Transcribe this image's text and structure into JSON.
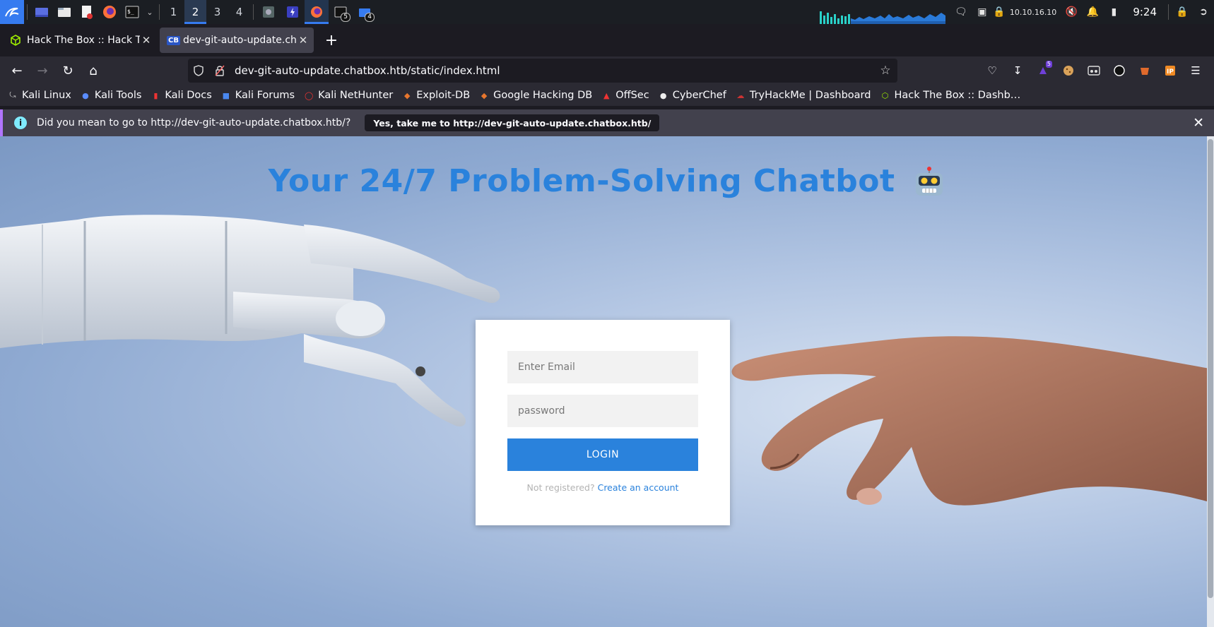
{
  "panel": {
    "workspaces": [
      "1",
      "2",
      "3",
      "4"
    ],
    "active_workspace": "2",
    "task_badges": [
      "5",
      "4"
    ],
    "ip": "10.10.16.10",
    "time": "9:24"
  },
  "tabs": [
    {
      "title": "Hack The Box :: Hack The Box",
      "icon": "htb-cube-icon",
      "active": false
    },
    {
      "title": "dev-git-auto-update.chatbox.htb/static/index.html",
      "icon_text": "CB",
      "active": true
    }
  ],
  "url": "dev-git-auto-update.chatbox.htb/static/index.html",
  "extension_badge": "5",
  "bookmarks": [
    "Kali Linux",
    "Kali Tools",
    "Kali Docs",
    "Kali Forums",
    "Kali NetHunter",
    "Exploit-DB",
    "Google Hacking DB",
    "OffSec",
    "CyberChef",
    "TryHackMe | Dashboard",
    "Hack The Box :: Dashb…"
  ],
  "notification": {
    "text": "Did you mean to go to http://dev-git-auto-update.chatbox.htb/?",
    "button": "Yes, take me to http://dev-git-auto-update.chatbox.htb/"
  },
  "page": {
    "headline": "Your 24/7 Problem-Solving Chatbot",
    "email_placeholder": "Enter Email",
    "password_placeholder": "password",
    "login_label": "LOGIN",
    "register_prompt": "Not registered?",
    "register_link": "Create an account"
  },
  "colors": {
    "accent": "#2a82dc",
    "kali_blue": "#367bf0"
  }
}
